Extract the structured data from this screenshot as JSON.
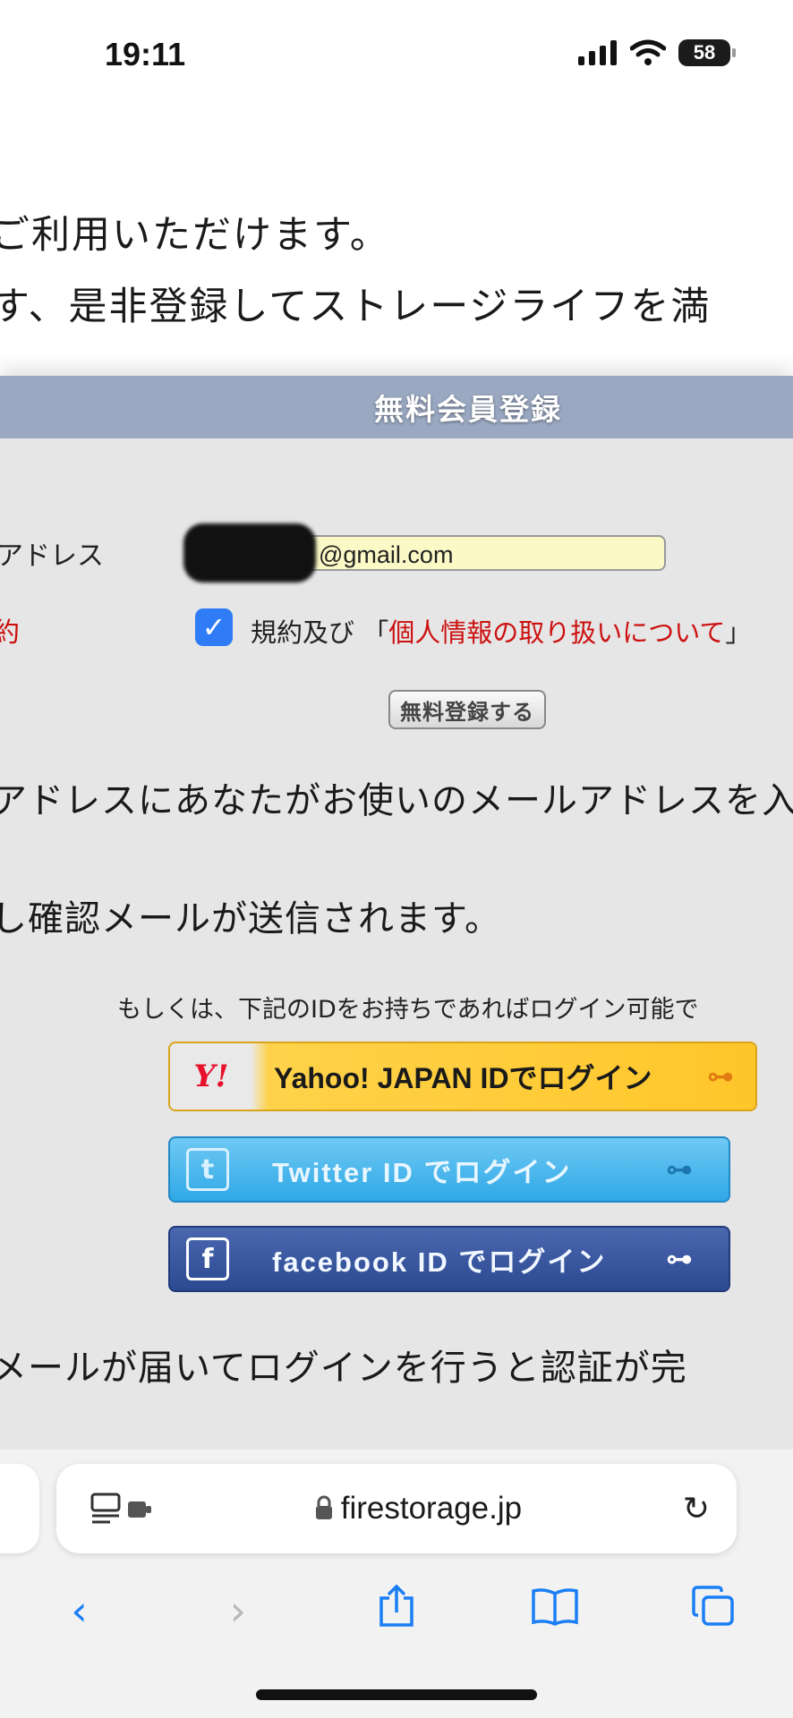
{
  "status_bar": {
    "time": "19:11",
    "battery": "58"
  },
  "intro_lines": [
    "ご利用いただけます。",
    "す、是非登録してストレージライフを満"
  ],
  "panel": {
    "header": "無料会員登録",
    "email_label": "アドレス",
    "email_value": "@gmail.com",
    "terms_label": "約",
    "terms_prefix": "規約及び 「",
    "terms_link": "個人情報の取り扱いについて",
    "terms_suffix": "」",
    "submit_label": "無料登録する",
    "line1": "アドレスにあなたがお使いのメールアドレスを入",
    "line2": "し確認メールが送信されます。",
    "login_note": "もしくは、下記のIDをお持ちであればログイン可能で",
    "yahoo_logo": "Y!",
    "yahoo_label": "Yahoo! JAPAN IDでログイン",
    "twitter_label": "Twitter ID でログイン",
    "facebook_label": "facebook ID でログイン",
    "line3": "メールが届いてログインを行うと認証が完"
  },
  "browser": {
    "domain": "firestorage.jp"
  },
  "colors": {
    "header": "#9aa8c2",
    "accent": "#1a7ef5",
    "link_red": "#cc1010"
  }
}
